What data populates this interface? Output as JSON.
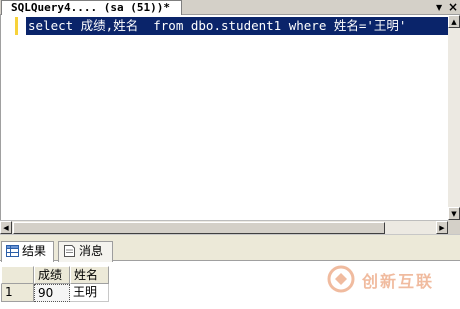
{
  "doc_tab": {
    "title": "SQLQuery4.... (sa (51))*"
  },
  "tab_controls": {
    "dropdown_glyph": "▼",
    "close_glyph": "×"
  },
  "editor": {
    "sql": "select 成绩,姓名  from dbo.student1 where 姓名='王明'"
  },
  "result_tabs": [
    {
      "label": "结果",
      "icon": "grid-icon",
      "active": true
    },
    {
      "label": "消息",
      "icon": "message-icon",
      "active": false
    }
  ],
  "grid": {
    "columns": [
      "成绩",
      "姓名"
    ],
    "rows": [
      {
        "row_number": "1",
        "cells": [
          "90",
          "王明"
        ]
      }
    ]
  },
  "watermark": {
    "text": "创新互联",
    "logo": "logo-icon"
  },
  "colors": {
    "selection": "#0a246a",
    "chrome": "#d4d0c8",
    "panel": "#ece9d8",
    "change_bar": "#f7d23a",
    "watermark": "#e06b2d"
  }
}
